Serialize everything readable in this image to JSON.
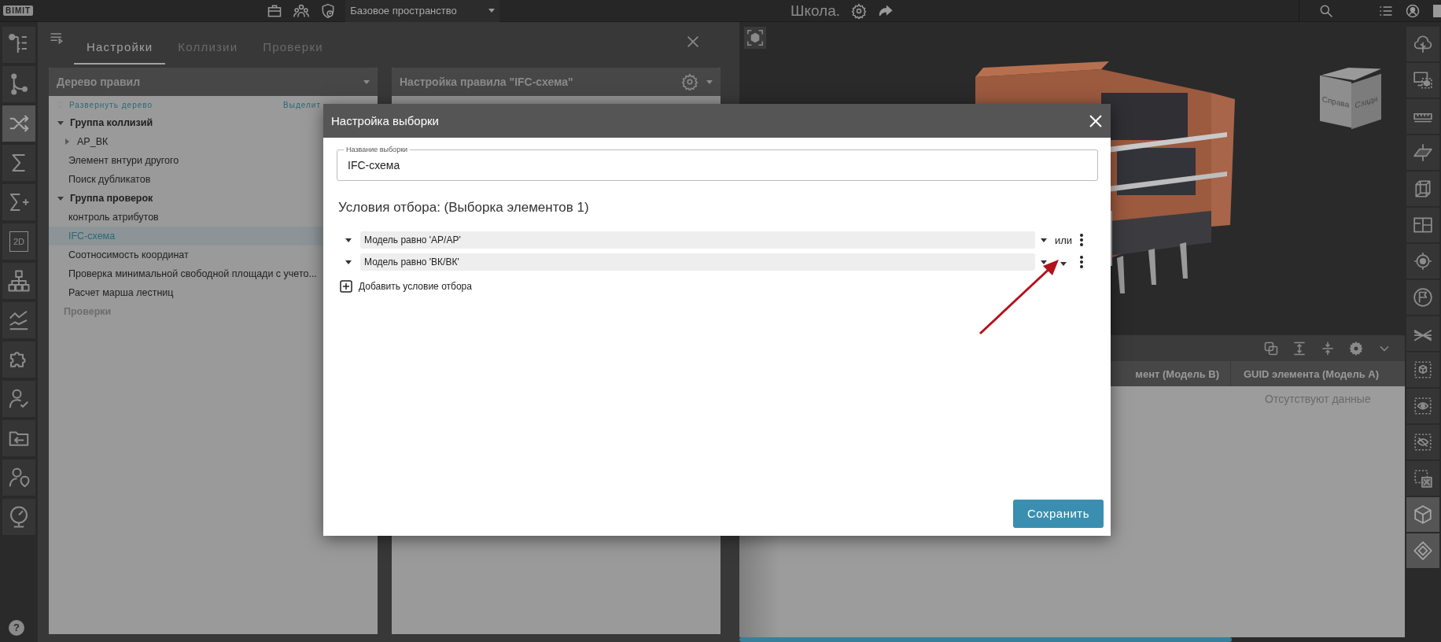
{
  "top_bar": {
    "logo": "BIMIT",
    "workspace": "Базовое пространство",
    "project": "Школа."
  },
  "left_toolbar": [
    {
      "kind": "tree",
      "selected": false
    },
    {
      "kind": "branch",
      "selected": false
    },
    {
      "kind": "shuffle",
      "selected": true
    },
    {
      "kind": "sigma",
      "selected": false
    },
    {
      "kind": "sigma-plus",
      "selected": false
    },
    {
      "kind": "sheet",
      "label": "2D",
      "selected": false
    },
    {
      "kind": "hierarchy",
      "selected": false
    },
    {
      "kind": "chart",
      "selected": false
    },
    {
      "kind": "puzzle",
      "selected": false
    },
    {
      "kind": "user-check",
      "selected": false
    },
    {
      "kind": "folder",
      "selected": false
    },
    {
      "kind": "user-pin",
      "selected": false
    },
    {
      "kind": "gauge",
      "selected": false
    }
  ],
  "help_button": "?",
  "tabs": [
    {
      "label": "Настройки",
      "selected": true
    },
    {
      "label": "Коллизии",
      "selected": false
    },
    {
      "label": "Проверки",
      "selected": false
    }
  ],
  "rule_tree": {
    "title": "Дерево правил",
    "expand_link": "Развернуть дерево",
    "select_link": "Выделит",
    "items": [
      {
        "label": "Группа коллизий",
        "kind": "group",
        "expanded": true,
        "selected": false,
        "disabled": false,
        "children": [
          {
            "label": "АР_ВК",
            "kind": "branch",
            "expanded": false,
            "selected": false,
            "disabled": false
          },
          {
            "label": "Элемент внтури другого",
            "kind": "rule",
            "selected": false,
            "disabled": false
          },
          {
            "label": "Поиск дубликатов",
            "kind": "rule",
            "selected": false,
            "disabled": false
          }
        ]
      },
      {
        "label": "Группа проверок",
        "kind": "group",
        "expanded": true,
        "selected": false,
        "disabled": false,
        "children": [
          {
            "label": "контроль атрибутов",
            "kind": "rule",
            "selected": false,
            "disabled": false
          },
          {
            "label": "IFC-схема",
            "kind": "rule",
            "selected": true,
            "disabled": false
          },
          {
            "label": "Соотносимость координат",
            "kind": "rule",
            "selected": false,
            "disabled": false
          },
          {
            "label": "Проверка минимальной свободной площади с учето...",
            "kind": "rule",
            "selected": false,
            "disabled": false
          },
          {
            "label": "Расчет марша лестниц",
            "kind": "rule",
            "selected": false,
            "disabled": false
          }
        ]
      },
      {
        "label": "Проверки",
        "kind": "plain",
        "selected": false,
        "disabled": true
      }
    ]
  },
  "rule_settings": {
    "title": "Настройка правила \"IFC-схема\""
  },
  "viewer": {
    "view_cube": [
      "Справа",
      "Сзади"
    ]
  },
  "results": {
    "columns": [
      "мент (Модель B)",
      "GUID элемента (Модель A)"
    ],
    "empty_message": "Отсутствуют данные"
  },
  "right_toolbar": [
    {
      "kind": "tree-cloud",
      "selected": false
    },
    {
      "kind": "screen-cube",
      "selected": false
    },
    {
      "kind": "ruler",
      "selected": false
    },
    {
      "kind": "section-plane",
      "selected": false
    },
    {
      "kind": "section-box",
      "selected": false
    },
    {
      "kind": "floorplan",
      "selected": false
    },
    {
      "kind": "target",
      "selected": false
    },
    {
      "kind": "flag",
      "selected": false
    },
    {
      "kind": "axes",
      "selected": false
    },
    {
      "kind": "select-cube",
      "selected": false
    },
    {
      "kind": "select-eye",
      "selected": false
    },
    {
      "kind": "select-eye-off",
      "selected": false
    },
    {
      "kind": "select-x",
      "selected": false
    },
    {
      "kind": "cube",
      "selected": true
    },
    {
      "kind": "diamond",
      "selected": true
    }
  ],
  "dialog": {
    "title": "Настройка выборки",
    "name_field": {
      "label": "Название выборки",
      "value": "IFC-схема"
    },
    "heading": "Условия отбора: (Выборка элементов 1)",
    "conditions": [
      {
        "text": "Модель равно 'АР/АР'",
        "operator": "или"
      },
      {
        "text": "Модель равно 'ВК/ВК'"
      }
    ],
    "add_condition": "Добавить условие отбора",
    "save_button": "Сохранить"
  }
}
